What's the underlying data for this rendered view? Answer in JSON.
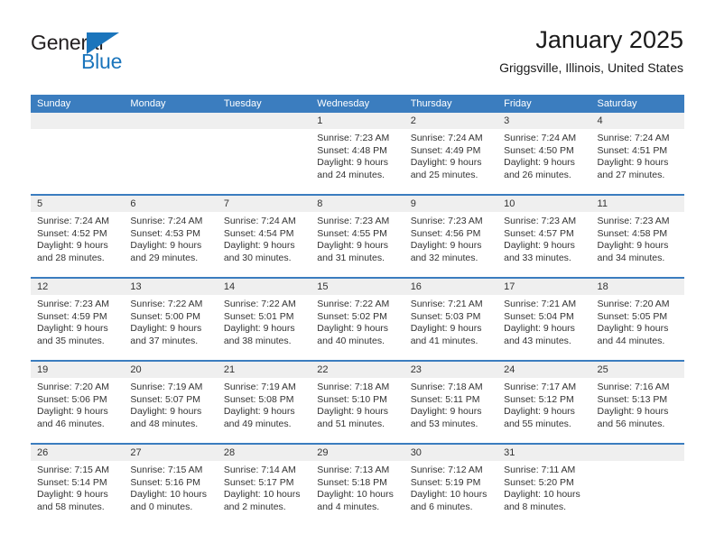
{
  "brand": {
    "name_top": "General",
    "name_bottom": "Blue",
    "triangle_color": "#1b75bc"
  },
  "header": {
    "title": "January 2025",
    "location": "Griggsville, Illinois, United States"
  },
  "theme": {
    "header_blue": "#3b7dbf",
    "date_band_gray": "#efefef",
    "text": "#333333"
  },
  "weekdays": [
    "Sunday",
    "Monday",
    "Tuesday",
    "Wednesday",
    "Thursday",
    "Friday",
    "Saturday"
  ],
  "weeks": [
    [
      {
        "day": "",
        "empty": true
      },
      {
        "day": "",
        "empty": true
      },
      {
        "day": "",
        "empty": true
      },
      {
        "day": "1",
        "sunrise": "Sunrise: 7:23 AM",
        "sunset": "Sunset: 4:48 PM",
        "daylight_1": "Daylight: 9 hours",
        "daylight_2": "and 24 minutes."
      },
      {
        "day": "2",
        "sunrise": "Sunrise: 7:24 AM",
        "sunset": "Sunset: 4:49 PM",
        "daylight_1": "Daylight: 9 hours",
        "daylight_2": "and 25 minutes."
      },
      {
        "day": "3",
        "sunrise": "Sunrise: 7:24 AM",
        "sunset": "Sunset: 4:50 PM",
        "daylight_1": "Daylight: 9 hours",
        "daylight_2": "and 26 minutes."
      },
      {
        "day": "4",
        "sunrise": "Sunrise: 7:24 AM",
        "sunset": "Sunset: 4:51 PM",
        "daylight_1": "Daylight: 9 hours",
        "daylight_2": "and 27 minutes."
      }
    ],
    [
      {
        "day": "5",
        "sunrise": "Sunrise: 7:24 AM",
        "sunset": "Sunset: 4:52 PM",
        "daylight_1": "Daylight: 9 hours",
        "daylight_2": "and 28 minutes."
      },
      {
        "day": "6",
        "sunrise": "Sunrise: 7:24 AM",
        "sunset": "Sunset: 4:53 PM",
        "daylight_1": "Daylight: 9 hours",
        "daylight_2": "and 29 minutes."
      },
      {
        "day": "7",
        "sunrise": "Sunrise: 7:24 AM",
        "sunset": "Sunset: 4:54 PM",
        "daylight_1": "Daylight: 9 hours",
        "daylight_2": "and 30 minutes."
      },
      {
        "day": "8",
        "sunrise": "Sunrise: 7:23 AM",
        "sunset": "Sunset: 4:55 PM",
        "daylight_1": "Daylight: 9 hours",
        "daylight_2": "and 31 minutes."
      },
      {
        "day": "9",
        "sunrise": "Sunrise: 7:23 AM",
        "sunset": "Sunset: 4:56 PM",
        "daylight_1": "Daylight: 9 hours",
        "daylight_2": "and 32 minutes."
      },
      {
        "day": "10",
        "sunrise": "Sunrise: 7:23 AM",
        "sunset": "Sunset: 4:57 PM",
        "daylight_1": "Daylight: 9 hours",
        "daylight_2": "and 33 minutes."
      },
      {
        "day": "11",
        "sunrise": "Sunrise: 7:23 AM",
        "sunset": "Sunset: 4:58 PM",
        "daylight_1": "Daylight: 9 hours",
        "daylight_2": "and 34 minutes."
      }
    ],
    [
      {
        "day": "12",
        "sunrise": "Sunrise: 7:23 AM",
        "sunset": "Sunset: 4:59 PM",
        "daylight_1": "Daylight: 9 hours",
        "daylight_2": "and 35 minutes."
      },
      {
        "day": "13",
        "sunrise": "Sunrise: 7:22 AM",
        "sunset": "Sunset: 5:00 PM",
        "daylight_1": "Daylight: 9 hours",
        "daylight_2": "and 37 minutes."
      },
      {
        "day": "14",
        "sunrise": "Sunrise: 7:22 AM",
        "sunset": "Sunset: 5:01 PM",
        "daylight_1": "Daylight: 9 hours",
        "daylight_2": "and 38 minutes."
      },
      {
        "day": "15",
        "sunrise": "Sunrise: 7:22 AM",
        "sunset": "Sunset: 5:02 PM",
        "daylight_1": "Daylight: 9 hours",
        "daylight_2": "and 40 minutes."
      },
      {
        "day": "16",
        "sunrise": "Sunrise: 7:21 AM",
        "sunset": "Sunset: 5:03 PM",
        "daylight_1": "Daylight: 9 hours",
        "daylight_2": "and 41 minutes."
      },
      {
        "day": "17",
        "sunrise": "Sunrise: 7:21 AM",
        "sunset": "Sunset: 5:04 PM",
        "daylight_1": "Daylight: 9 hours",
        "daylight_2": "and 43 minutes."
      },
      {
        "day": "18",
        "sunrise": "Sunrise: 7:20 AM",
        "sunset": "Sunset: 5:05 PM",
        "daylight_1": "Daylight: 9 hours",
        "daylight_2": "and 44 minutes."
      }
    ],
    [
      {
        "day": "19",
        "sunrise": "Sunrise: 7:20 AM",
        "sunset": "Sunset: 5:06 PM",
        "daylight_1": "Daylight: 9 hours",
        "daylight_2": "and 46 minutes."
      },
      {
        "day": "20",
        "sunrise": "Sunrise: 7:19 AM",
        "sunset": "Sunset: 5:07 PM",
        "daylight_1": "Daylight: 9 hours",
        "daylight_2": "and 48 minutes."
      },
      {
        "day": "21",
        "sunrise": "Sunrise: 7:19 AM",
        "sunset": "Sunset: 5:08 PM",
        "daylight_1": "Daylight: 9 hours",
        "daylight_2": "and 49 minutes."
      },
      {
        "day": "22",
        "sunrise": "Sunrise: 7:18 AM",
        "sunset": "Sunset: 5:10 PM",
        "daylight_1": "Daylight: 9 hours",
        "daylight_2": "and 51 minutes."
      },
      {
        "day": "23",
        "sunrise": "Sunrise: 7:18 AM",
        "sunset": "Sunset: 5:11 PM",
        "daylight_1": "Daylight: 9 hours",
        "daylight_2": "and 53 minutes."
      },
      {
        "day": "24",
        "sunrise": "Sunrise: 7:17 AM",
        "sunset": "Sunset: 5:12 PM",
        "daylight_1": "Daylight: 9 hours",
        "daylight_2": "and 55 minutes."
      },
      {
        "day": "25",
        "sunrise": "Sunrise: 7:16 AM",
        "sunset": "Sunset: 5:13 PM",
        "daylight_1": "Daylight: 9 hours",
        "daylight_2": "and 56 minutes."
      }
    ],
    [
      {
        "day": "26",
        "sunrise": "Sunrise: 7:15 AM",
        "sunset": "Sunset: 5:14 PM",
        "daylight_1": "Daylight: 9 hours",
        "daylight_2": "and 58 minutes."
      },
      {
        "day": "27",
        "sunrise": "Sunrise: 7:15 AM",
        "sunset": "Sunset: 5:16 PM",
        "daylight_1": "Daylight: 10 hours",
        "daylight_2": "and 0 minutes."
      },
      {
        "day": "28",
        "sunrise": "Sunrise: 7:14 AM",
        "sunset": "Sunset: 5:17 PM",
        "daylight_1": "Daylight: 10 hours",
        "daylight_2": "and 2 minutes."
      },
      {
        "day": "29",
        "sunrise": "Sunrise: 7:13 AM",
        "sunset": "Sunset: 5:18 PM",
        "daylight_1": "Daylight: 10 hours",
        "daylight_2": "and 4 minutes."
      },
      {
        "day": "30",
        "sunrise": "Sunrise: 7:12 AM",
        "sunset": "Sunset: 5:19 PM",
        "daylight_1": "Daylight: 10 hours",
        "daylight_2": "and 6 minutes."
      },
      {
        "day": "31",
        "sunrise": "Sunrise: 7:11 AM",
        "sunset": "Sunset: 5:20 PM",
        "daylight_1": "Daylight: 10 hours",
        "daylight_2": "and 8 minutes."
      },
      {
        "day": "",
        "empty": true
      }
    ]
  ]
}
